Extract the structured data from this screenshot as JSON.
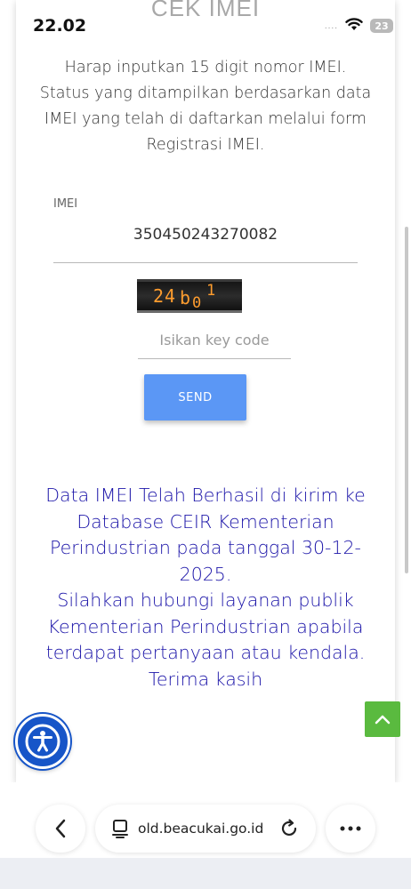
{
  "status_bar": {
    "time": "22.02",
    "battery": "23",
    "signal_dots": "....",
    "icons": [
      "wifi-icon",
      "battery-icon"
    ]
  },
  "page": {
    "heading": "CEK IMEI",
    "intro_lines": [
      "Harap inputkan 15 digit nomor IMEI.",
      "Status yang ditampilkan berdasarkan data",
      "IMEI yang telah di daftarkan melalui form",
      "Registrasi IMEI."
    ]
  },
  "form": {
    "imei_label": "IMEI",
    "imei_value": "350450243270082",
    "captcha_text": "24b01",
    "keycode_placeholder": "Isikan key code",
    "keycode_value": "",
    "send_label": "SEND"
  },
  "result": {
    "lines": [
      "Data IMEI Telah Berhasil di kirim ke",
      "Database CEIR Kementerian",
      "Perindustrian pada tanggal 30-12-",
      "2025.",
      "Silahkan hubungi layanan publik",
      "Kementerian Perindustrian apabila",
      "terdapat pertanyaan atau kendala.",
      "Terima kasih"
    ]
  },
  "browser": {
    "url": "old.beacukai.go.id",
    "icons": [
      "back-icon",
      "page-icon",
      "reload-icon",
      "more-icon"
    ]
  },
  "colors": {
    "accent_button": "#5b97f5",
    "result_text": "#1b14a8",
    "accessibility_button": "#1755c8",
    "scroll_top_button": "#5aba3f",
    "captcha_text": "#ff9d2e"
  }
}
